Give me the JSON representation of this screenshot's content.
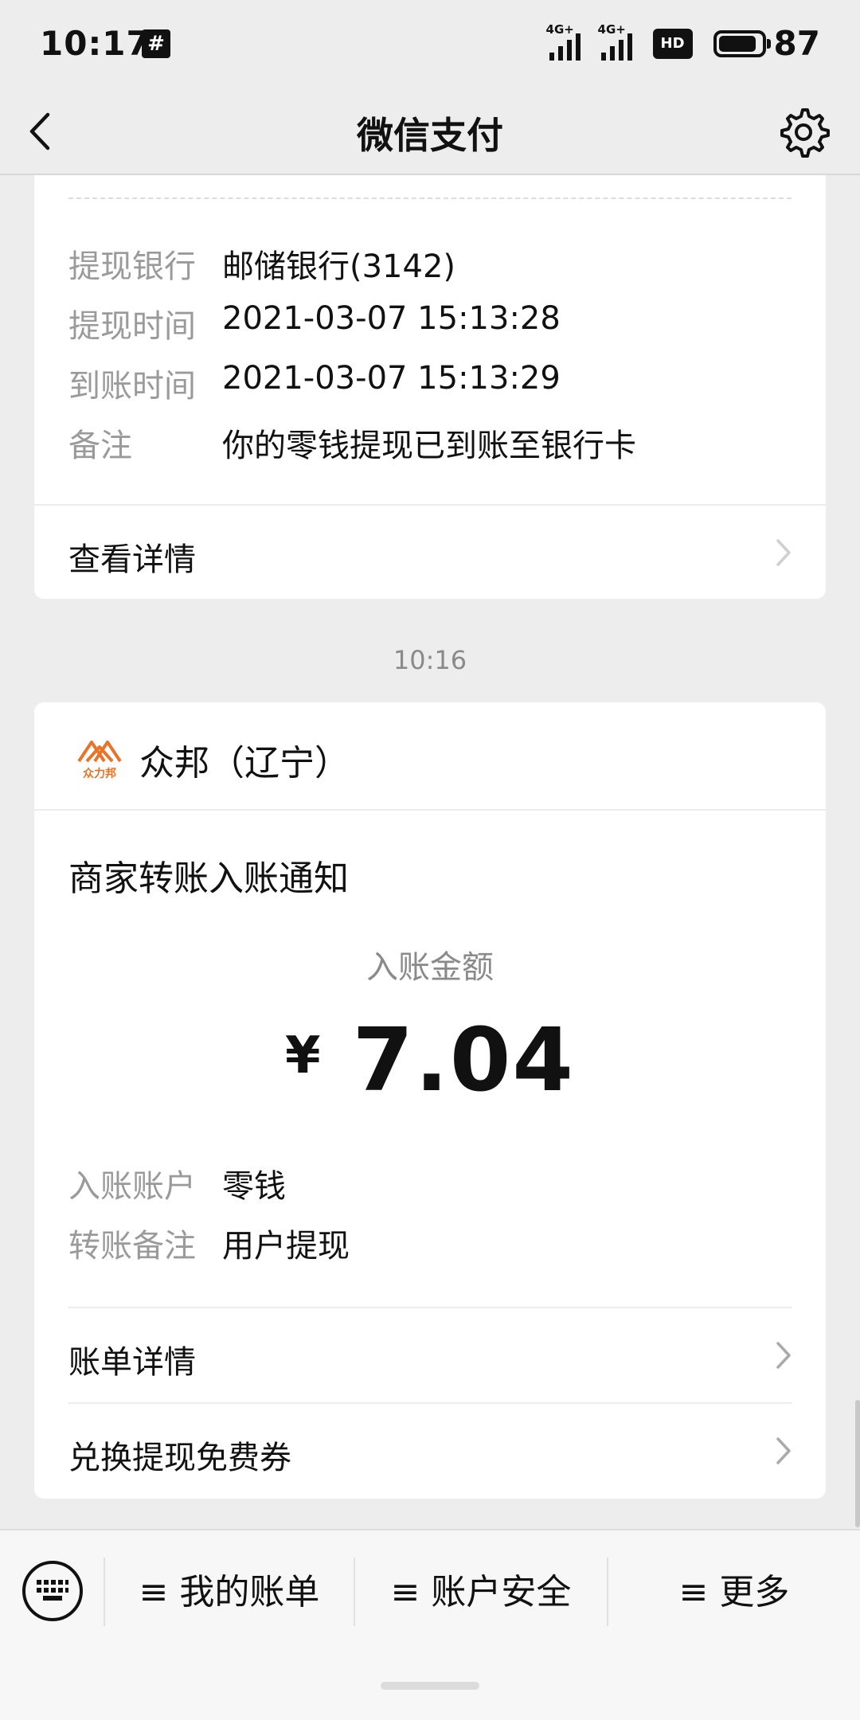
{
  "status_bar": {
    "time": "10:17",
    "notification_glyph": "#",
    "signal_tag_1": "4G+",
    "signal_tag_2": "4G+",
    "hd_badge": "HD",
    "battery": "87"
  },
  "nav": {
    "title": "微信支付",
    "back_icon": "chevron-left-icon",
    "settings_icon": "gear-icon"
  },
  "withdraw_card": {
    "rows": [
      {
        "label": "提现银行",
        "value": "邮储银行(3142)"
      },
      {
        "label": "提现时间",
        "value": "2021-03-07 15:13:28"
      },
      {
        "label": "到账时间",
        "value": "2021-03-07 15:13:29"
      },
      {
        "label": "备注",
        "value": "你的零钱提现已到账至银行卡"
      }
    ],
    "details_link": "查看详情"
  },
  "timestamp": "10:16",
  "transfer_card": {
    "merchant_name": "众邦（辽宁）",
    "logo_text": "众力邦",
    "notice_title": "商家转账入账通知",
    "amount_label": "入账金额",
    "currency": "¥",
    "amount": "7.04",
    "rows": [
      {
        "label": "入账账户",
        "value": "零钱"
      },
      {
        "label": "转账备注",
        "value": "用户提现"
      }
    ],
    "links": [
      "账单详情",
      "兑换提现免费券"
    ]
  },
  "bottom_menu": {
    "keyboard_icon": "keyboard-icon",
    "items": [
      "≡ 我的账单",
      "≡ 账户安全",
      "≡ 更多"
    ]
  },
  "colors": {
    "background": "#ededed",
    "card": "#ffffff",
    "label_gray": "#9a9a9a",
    "logo_orange": "#e8742a"
  }
}
